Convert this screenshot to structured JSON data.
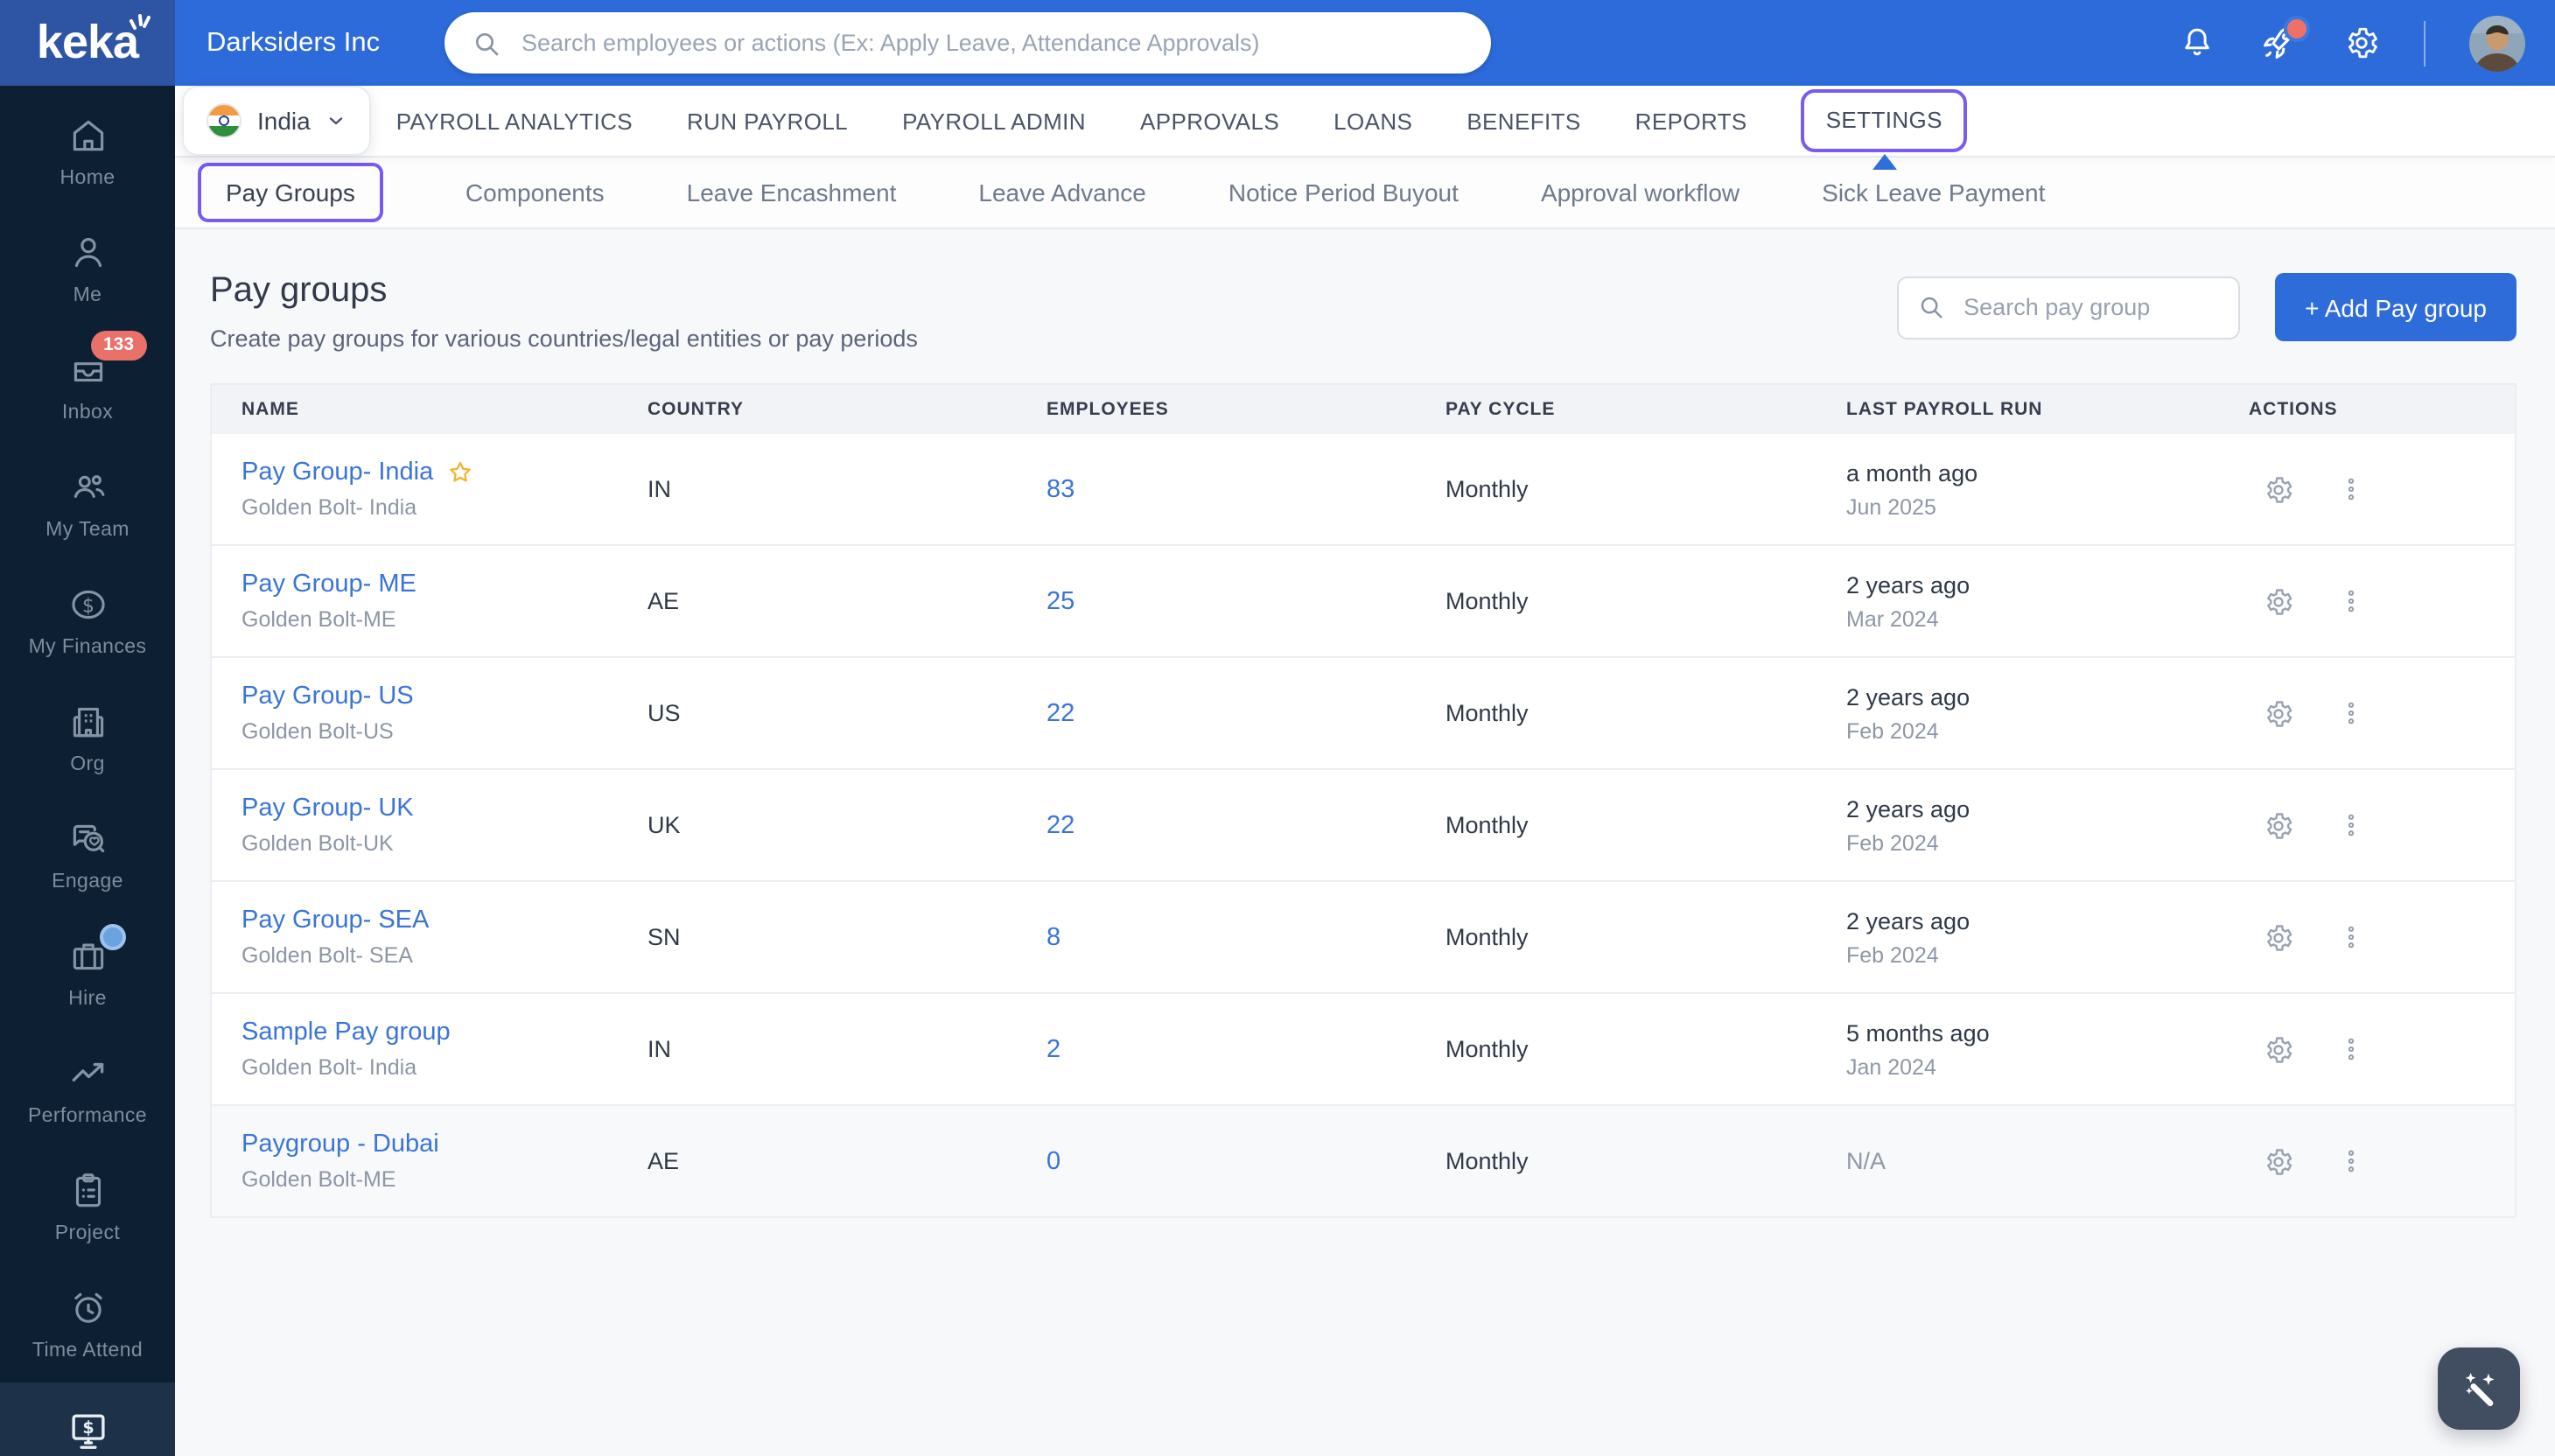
{
  "topbar": {
    "brand": "keka",
    "company": "Darksiders Inc",
    "search_placeholder": "Search employees or actions (Ex: Apply Leave, Attendance Approvals)"
  },
  "sidebar": {
    "items": [
      {
        "label": "Home"
      },
      {
        "label": "Me"
      },
      {
        "label": "Inbox",
        "badge": "133"
      },
      {
        "label": "My Team"
      },
      {
        "label": "My Finances"
      },
      {
        "label": "Org"
      },
      {
        "label": "Engage"
      },
      {
        "label": "Hire"
      },
      {
        "label": "Performance"
      },
      {
        "label": "Project"
      },
      {
        "label": "Time Attend"
      },
      {
        "label": ""
      }
    ]
  },
  "nav": {
    "country": "India",
    "tabs": [
      "PAYROLL ANALYTICS",
      "RUN PAYROLL",
      "PAYROLL ADMIN",
      "APPROVALS",
      "LOANS",
      "BENEFITS",
      "REPORTS",
      "SETTINGS"
    ],
    "active_tab": "SETTINGS"
  },
  "subnav": {
    "tabs": [
      "Pay Groups",
      "Components",
      "Leave Encashment",
      "Leave Advance",
      "Notice Period Buyout",
      "Approval workflow",
      "Sick Leave Payment"
    ],
    "active_tab": "Pay Groups"
  },
  "page": {
    "title": "Pay groups",
    "subtitle": "Create pay groups for various countries/legal entities or pay periods",
    "search_placeholder": "Search pay group",
    "add_button_label": "+ Add Pay group"
  },
  "table": {
    "columns": [
      "NAME",
      "COUNTRY",
      "EMPLOYEES",
      "PAY CYCLE",
      "LAST PAYROLL RUN",
      "ACTIONS"
    ],
    "rows": [
      {
        "name": "Pay Group- India",
        "entity": "Golden Bolt- India",
        "country": "IN",
        "employees": "83",
        "pay_cycle": "Monthly",
        "last_run": "a month ago",
        "last_run_date": "Jun 2025",
        "starred": true
      },
      {
        "name": "Pay Group- ME",
        "entity": "Golden Bolt-ME",
        "country": "AE",
        "employees": "25",
        "pay_cycle": "Monthly",
        "last_run": "2 years ago",
        "last_run_date": "Mar 2024"
      },
      {
        "name": "Pay Group- US",
        "entity": "Golden Bolt-US",
        "country": "US",
        "employees": "22",
        "pay_cycle": "Monthly",
        "last_run": "2 years ago",
        "last_run_date": "Feb 2024"
      },
      {
        "name": "Pay Group- UK",
        "entity": "Golden Bolt-UK",
        "country": "UK",
        "employees": "22",
        "pay_cycle": "Monthly",
        "last_run": "2 years ago",
        "last_run_date": "Feb 2024"
      },
      {
        "name": "Pay Group- SEA",
        "entity": "Golden Bolt- SEA",
        "country": "SN",
        "employees": "8",
        "pay_cycle": "Monthly",
        "last_run": "2 years ago",
        "last_run_date": "Feb 2024"
      },
      {
        "name": "Sample Pay group",
        "entity": "Golden Bolt- India",
        "country": "IN",
        "employees": "2",
        "pay_cycle": "Monthly",
        "last_run": "5 months ago",
        "last_run_date": "Jan 2024"
      },
      {
        "name": "Paygroup - Dubai",
        "entity": "Golden Bolt-ME",
        "country": "AE",
        "employees": "0",
        "pay_cycle": "Monthly",
        "last_run": "N/A"
      }
    ]
  },
  "colors": {
    "topbar_blue": "#2d6bdb",
    "logo_segment_blue": "#2e54a4",
    "sidebar_navy": "#0d1f32",
    "accent_blue": "#2e6cd9",
    "highlight_purple": "#7a5af0",
    "link_blue": "#3a74d8",
    "badge_red": "#e9716a",
    "star_gold": "#f0b429"
  }
}
